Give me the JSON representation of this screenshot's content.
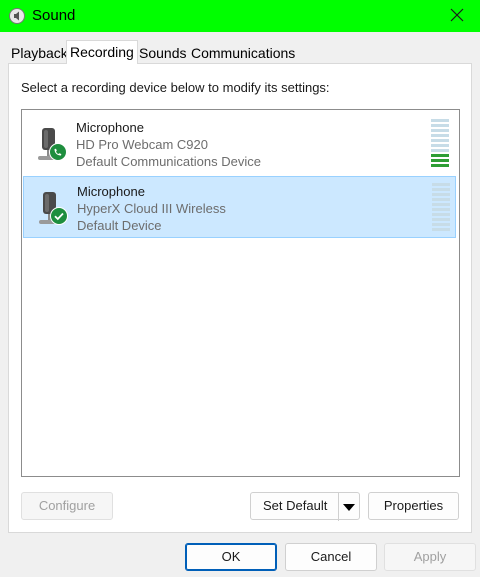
{
  "window": {
    "title": "Sound",
    "app_icon": "speaker-icon",
    "close_icon": "close-icon"
  },
  "tabs": [
    {
      "label": "Playback",
      "active": false
    },
    {
      "label": "Recording",
      "active": true
    },
    {
      "label": "Sounds",
      "active": false
    },
    {
      "label": "Communications",
      "active": false
    }
  ],
  "instruction": "Select a recording device below to modify its settings:",
  "devices": [
    {
      "name": "Microphone",
      "model": "HD Pro Webcam C920",
      "status": "Default Communications Device",
      "badge_icon": "phone-icon",
      "selected": false,
      "level": 0.25
    },
    {
      "name": "Microphone",
      "model": "HyperX Cloud III Wireless",
      "status": "Default Device",
      "badge_icon": "checkmark-icon",
      "selected": true,
      "level": 0
    }
  ],
  "buttons": {
    "configure": "Configure",
    "set_default": "Set Default",
    "properties": "Properties",
    "ok": "OK",
    "cancel": "Cancel",
    "apply": "Apply"
  },
  "colors": {
    "titlebar": "#00ff00",
    "selection": "#cce8ff",
    "badge_green": "#1e8e3e",
    "meter_on": "#2e9e35",
    "meter_off": "#c7dce7"
  }
}
